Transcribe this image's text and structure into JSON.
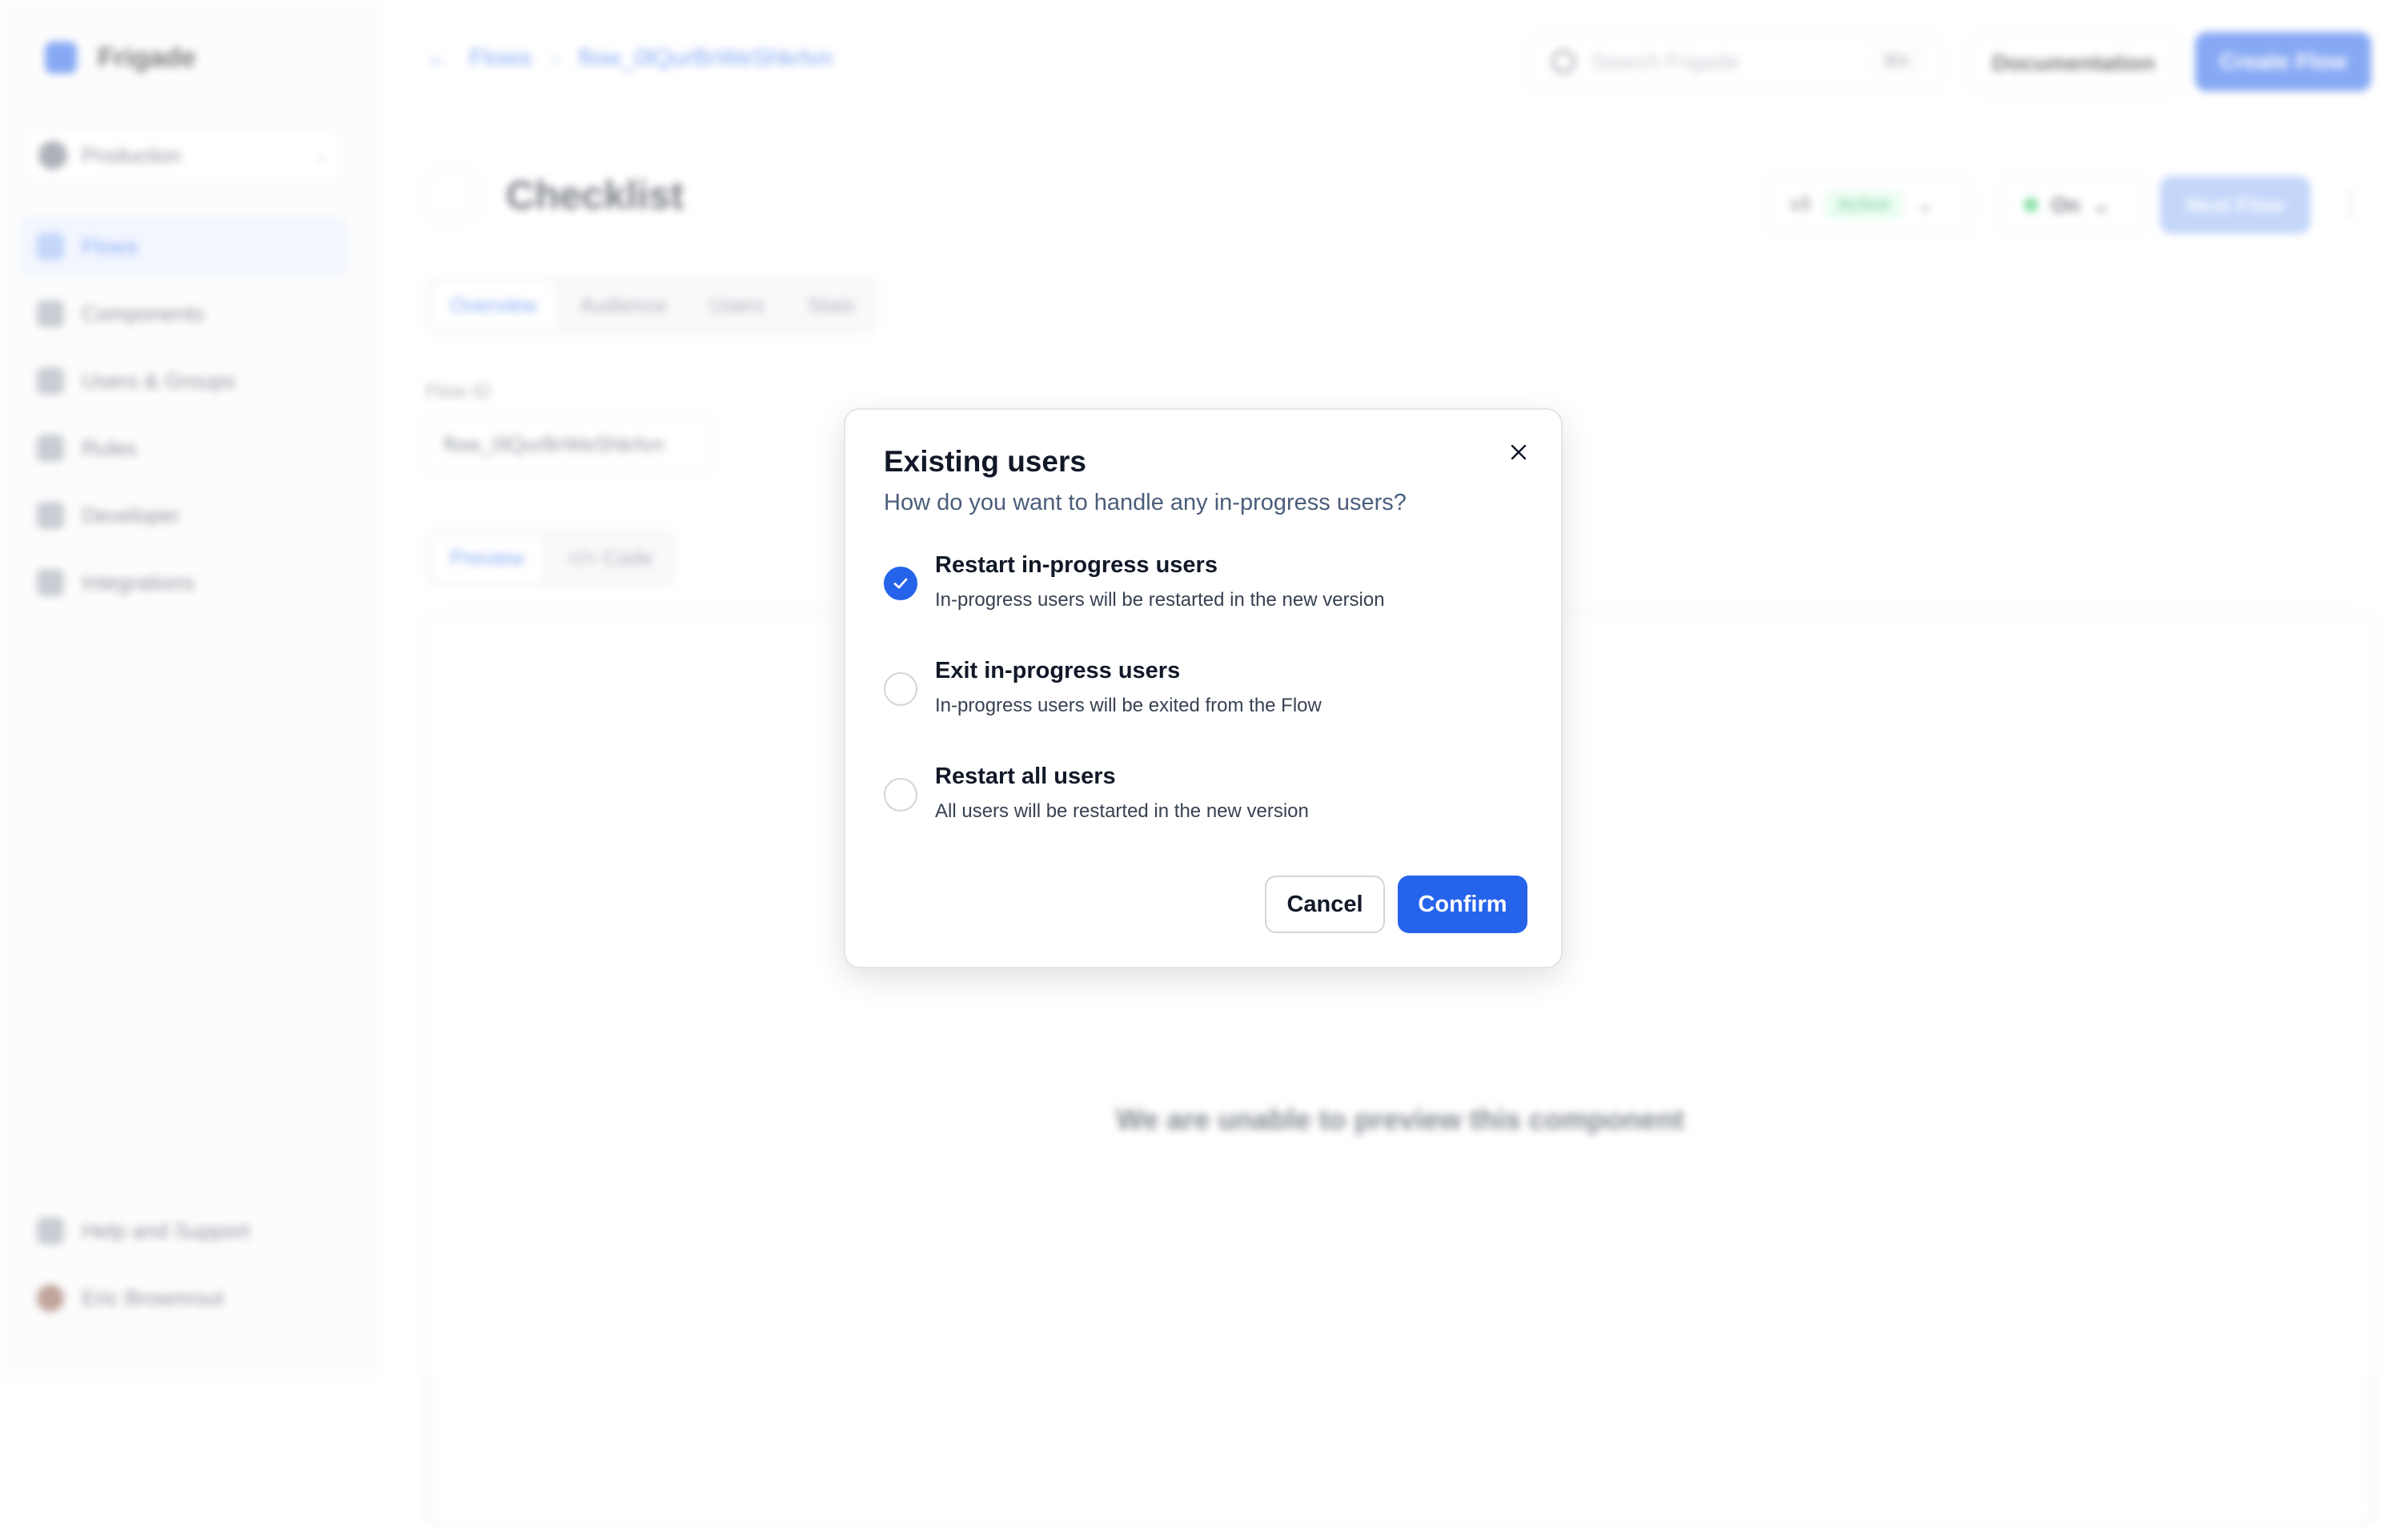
{
  "app": {
    "name": "Frigade",
    "environment": "Production",
    "nav": [
      "Flows",
      "Components",
      "Users & Groups",
      "Rules",
      "Developer",
      "Integrations"
    ],
    "nav_bottom": [
      "Help and Support",
      "Eric Brownrout"
    ],
    "breadcrumb": [
      "Flows",
      "flow_0lQurBrWeShkrlvn"
    ],
    "search_placeholder": "Search Frigade",
    "search_shortcut": "⌘K",
    "documentation_label": "Documentation",
    "create_label": "Create Flow",
    "page_title": "Checklist",
    "version_label": "v3",
    "status_badge": "Active",
    "toggle_label": "On",
    "publish_label": "Next Flow",
    "tabs": [
      "Overview",
      "Audience",
      "Users",
      "Stats"
    ],
    "flow_id_label": "Flow ID",
    "flow_id_value": "flow_0lQurBrWeShkrlvn",
    "preview_tabs": [
      "Preview",
      "</> Code"
    ],
    "preview_message": "We are unable to preview this component"
  },
  "modal": {
    "title": "Existing users",
    "subtitle": "How do you want to handle any in-progress users?",
    "options": [
      {
        "title": "Restart in-progress users",
        "description": "In-progress users will be restarted in the new version",
        "selected": true
      },
      {
        "title": "Exit in-progress users",
        "description": "In-progress users will be exited from the Flow",
        "selected": false
      },
      {
        "title": "Restart all users",
        "description": "All users will be restarted in the new version",
        "selected": false
      }
    ],
    "cancel_label": "Cancel",
    "confirm_label": "Confirm",
    "accent_color": "#2563eb"
  }
}
